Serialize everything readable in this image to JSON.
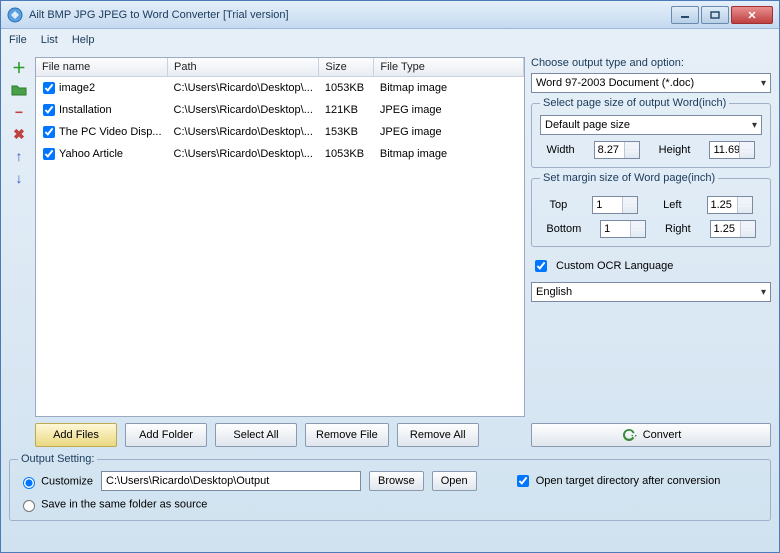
{
  "window": {
    "title": "Ailt BMP JPG JPEG to Word Converter [Trial version]"
  },
  "menu": {
    "file": "File",
    "list": "List",
    "help": "Help"
  },
  "columns": {
    "filename": "File name",
    "path": "Path",
    "size": "Size",
    "filetype": "File Type"
  },
  "files": [
    {
      "name": "image2",
      "path": "C:\\Users\\Ricardo\\Desktop\\...",
      "size": "1053KB",
      "type": "Bitmap image"
    },
    {
      "name": "Installation",
      "path": "C:\\Users\\Ricardo\\Desktop\\...",
      "size": "121KB",
      "type": "JPEG image"
    },
    {
      "name": "The PC Video Disp...",
      "path": "C:\\Users\\Ricardo\\Desktop\\...",
      "size": "153KB",
      "type": "JPEG image"
    },
    {
      "name": "Yahoo Article",
      "path": "C:\\Users\\Ricardo\\Desktop\\...",
      "size": "1053KB",
      "type": "Bitmap image"
    }
  ],
  "buttons": {
    "addFiles": "Add Files",
    "addFolder": "Add Folder",
    "selectAll": "Select All",
    "removeFile": "Remove File",
    "removeAll": "Remove All",
    "convert": "Convert",
    "browse": "Browse",
    "open": "Open"
  },
  "right": {
    "chooseLabel": "Choose output type and option:",
    "outputType": "Word 97-2003 Document (*.doc)",
    "pageSize": {
      "legend": "Select page size of output Word(inch)",
      "default": "Default page size",
      "widthLbl": "Width",
      "width": "8.27",
      "heightLbl": "Height",
      "height": "11.69"
    },
    "margin": {
      "legend": "Set margin size of Word page(inch)",
      "topLbl": "Top",
      "top": "1",
      "leftLbl": "Left",
      "left": "1.25",
      "bottomLbl": "Bottom",
      "bottom": "1",
      "rightLbl": "Right",
      "right": "1.25"
    },
    "ocrLabel": "Custom OCR Language",
    "ocrLang": "English"
  },
  "output": {
    "legend": "Output Setting:",
    "customize": "Customize",
    "path": "C:\\Users\\Ricardo\\Desktop\\Output",
    "sameFolder": "Save in the same folder as source",
    "openTarget": "Open target directory after conversion"
  }
}
